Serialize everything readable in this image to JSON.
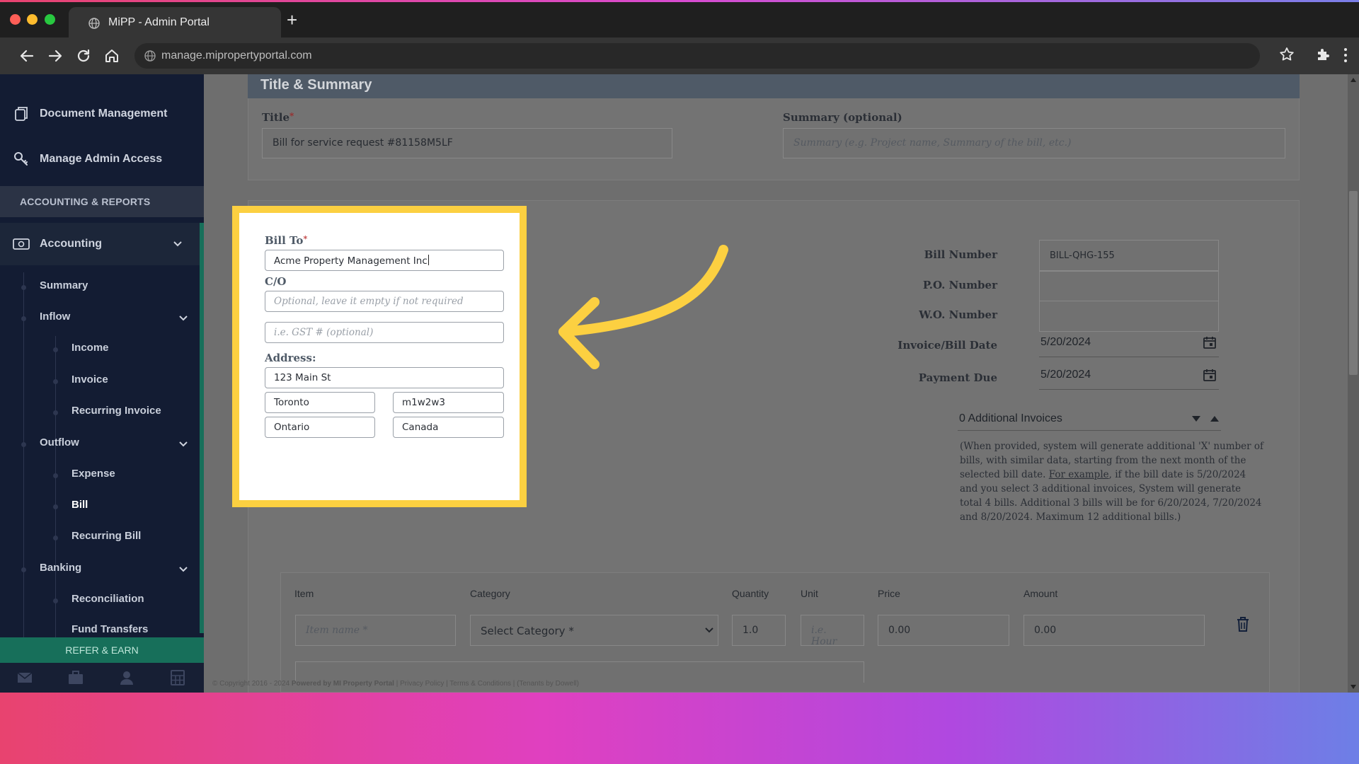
{
  "browser": {
    "tab_title": "MiPP - Admin Portal",
    "url": "manage.mipropertyportal.com"
  },
  "sidebar": {
    "doc_mgmt": "Document Management",
    "admin_access": "Manage Admin Access",
    "section_header": "ACCOUNTING & REPORTS",
    "accounting": "Accounting",
    "items": {
      "summary": "Summary",
      "inflow": "Inflow",
      "income": "Income",
      "invoice": "Invoice",
      "recurring_invoice": "Recurring Invoice",
      "outflow": "Outflow",
      "expense": "Expense",
      "bill": "Bill",
      "recurring_bill": "Recurring Bill",
      "banking": "Banking",
      "reconciliation": "Reconciliation",
      "fund_transfers": "Fund Transfers"
    },
    "refer": "REFER & EARN"
  },
  "title_summary": {
    "header": "Title & Summary",
    "title_label": "Title",
    "title_value": "Bill for service request #81158M5LF",
    "summary_label": "Summary (optional)",
    "summary_placeholder": "Summary (e.g. Project name, Summary of the bill, etc.)"
  },
  "bill_to": {
    "label": "Bill To",
    "value": "Acme Property Management Inc",
    "co_label": "C/O",
    "co_placeholder": "Optional, leave it empty if not required",
    "gst_placeholder": "i.e. GST # (optional)",
    "address_label": "Address:",
    "street": "123 Main St",
    "city": "Toronto",
    "postal": "m1w2w3",
    "province": "Ontario",
    "country": "Canada"
  },
  "bill_info": {
    "bill_number_label": "Bill Number",
    "bill_number": "BILL-QHG-155",
    "po_label": "P.O. Number",
    "wo_label": "W.O. Number",
    "invoice_date_label": "Invoice/Bill Date",
    "invoice_date": "5/20/2024",
    "payment_due_label": "Payment Due",
    "payment_due": "5/20/2024",
    "additional_invoices": "0 Additional Invoices",
    "note_part1": "(When provided, system will generate additional 'X' number of bills, with similar data, starting from the next month of the selected bill date. ",
    "note_link": "For example",
    "note_part2": ", if the bill date is 5/20/2024 and you select 3 additional invoices, System will generate total 4 bills. Additional 3 bills will be for 6/20/2024, 7/20/2024 and 8/20/2024. Maximum 12 additional bills.)"
  },
  "items": {
    "headers": {
      "item": "Item",
      "category": "Category",
      "quantity": "Quantity",
      "unit": "Unit",
      "price": "Price",
      "amount": "Amount"
    },
    "item_placeholder": "Item name *",
    "category_value": "Select Category *",
    "quantity": "1.0",
    "unit_placeholder": "i.e. Hour",
    "price": "0.00",
    "amount": "0.00"
  },
  "footer": {
    "copyright": "© Copyright 2016 - 2024",
    "powered": "Powered by MI Property Portal",
    "links": "| Privacy Policy | Terms & Conditions | (Tenants by Dowell)"
  },
  "colors": {
    "highlight": "#fcd041",
    "sidebar_bg": "#131c33",
    "accent_green": "#176f5a"
  }
}
